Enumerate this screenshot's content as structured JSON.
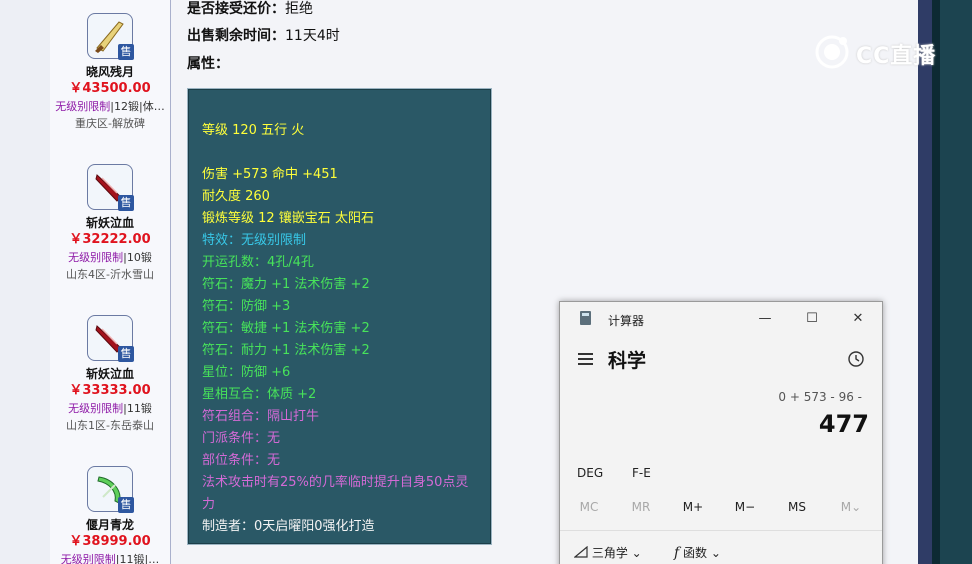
{
  "sidebar": {
    "items": [
      {
        "name": "晓风残月",
        "price": "￥43500.00",
        "limit": "无级别限制",
        "extra": "|12锻|体…",
        "server": "重庆区-解放碑",
        "sale": "售"
      },
      {
        "name": "斩妖泣血",
        "price": "￥32222.00",
        "limit": "无级别限制",
        "extra": "|10锻",
        "server": "山东4区-沂水雪山",
        "sale": "售"
      },
      {
        "name": "斩妖泣血",
        "price": "￥33333.00",
        "limit": "无级别限制",
        "extra": "|11锻",
        "server": "山东1区-东岳泰山",
        "sale": "售"
      },
      {
        "name": "偃月青龙",
        "price": "￥38999.00",
        "limit": "无级别限制",
        "extra": "|11锻|…",
        "server": "",
        "sale": "售"
      }
    ]
  },
  "details": {
    "bargain_label": "是否接受还价：",
    "bargain_value": "拒绝",
    "time_label": "出售剩余时间：",
    "time_value": "11天4时",
    "attr_label": "属性："
  },
  "attributes": {
    "lines": [
      "等级 120 五行 火",
      "伤害 +573 命中 +451",
      "耐久度 260",
      "锻炼等级 12 镶嵌宝石 太阳石",
      "特效：无级别限制",
      "开运孔数：4孔/4孔",
      "符石：魔力 +1 法术伤害 +2",
      "符石：防御 +3",
      "符石：敏捷 +1 法术伤害 +2",
      "符石：耐力 +1 法术伤害 +2",
      "星位：防御 +6",
      "星相互合：体质 +2",
      "符石组合：隔山打牛",
      "门派条件：无",
      "部位条件：无",
      "法术攻击时有25%的几率临时提升自身50点灵",
      "力",
      "制造者：0天启曜阳0强化打造"
    ]
  },
  "watermark": {
    "text": "CC直播"
  },
  "calculator": {
    "title": "计算器",
    "minimize": "—",
    "maximize": "☐",
    "close": "✕",
    "mode": "科学",
    "expression": "0 + 573 - 96 -",
    "result": "477",
    "deg": "DEG",
    "fe": "F-E",
    "memory": [
      "MC",
      "MR",
      "M+",
      "M−",
      "MS",
      "M⌄"
    ],
    "trig": "三角学",
    "func": "函数"
  },
  "colors": {
    "attr_bg": "#2a5866",
    "yellow": "#ffff3a",
    "cyan": "#38c8e8",
    "green": "#47e35a",
    "purple": "#d36ad6",
    "price_red": "#e0131e"
  }
}
